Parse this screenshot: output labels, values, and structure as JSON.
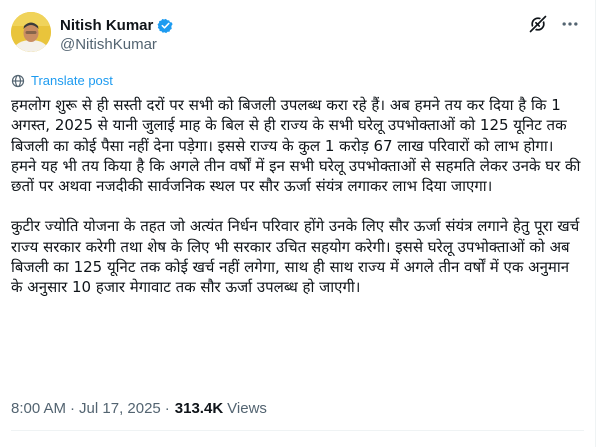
{
  "author": {
    "name": "Nitish Kumar",
    "handle": "@NitishKumar",
    "verified_color": "#1d9bf0"
  },
  "toolbar": {
    "grok_icon": "grok-icon",
    "more_icon": "more-options-icon"
  },
  "translate": {
    "label": "Translate post",
    "icon": "globe-icon",
    "color": "#1d9bf0"
  },
  "post": {
    "paragraph_1": "हमलोग शुरू से ही सस्ती दरों पर सभी को बिजली उपलब्ध करा रहे हैं। अब हमने तय कर दिया है कि 1 अगस्त, 2025 से यानी जुलाई माह के बिल से ही राज्य के सभी घरेलू उपभोक्ताओं को 125 यूनिट तक बिजली का कोई पैसा नहीं देना पड़ेगा। इससे राज्य के कुल 1 करोड़ 67 लाख परिवारों को लाभ होगा। हमने यह भी तय किया है कि अगले तीन वर्षों में इन सभी घरेलू उपभोक्ताओं से सहमति लेकर उनके घर की छतों पर अथवा नजदीकी सार्वजनिक स्थल पर सौर ऊर्जा संयंत्र लगाकर लाभ दिया जाएगा।",
    "paragraph_2": "कुटीर ज्योति योजना के तहत जो अत्यंत निर्धन परिवार होंगे उनके लिए सौर ऊर्जा संयंत्र लगाने हेतु पूरा खर्च राज्य सरकार करेगी तथा शेष के लिए भी सरकार उचित सहयोग करेगी। इससे घरेलू उपभोक्ताओं को अब बिजली का 125 यूनिट तक कोई खर्च नहीं लगेगा, साथ ही साथ राज्य में अगले तीन वर्षों में एक अनुमान के अनुसार 10 हजार मेगावाट तक सौर ऊर्जा उपलब्ध हो जाएगी।"
  },
  "meta": {
    "time": "8:00 AM",
    "separator": "·",
    "date": "Jul 17, 2025",
    "separator_2": "·",
    "views_count": "313.4K",
    "views_label": "Views"
  }
}
